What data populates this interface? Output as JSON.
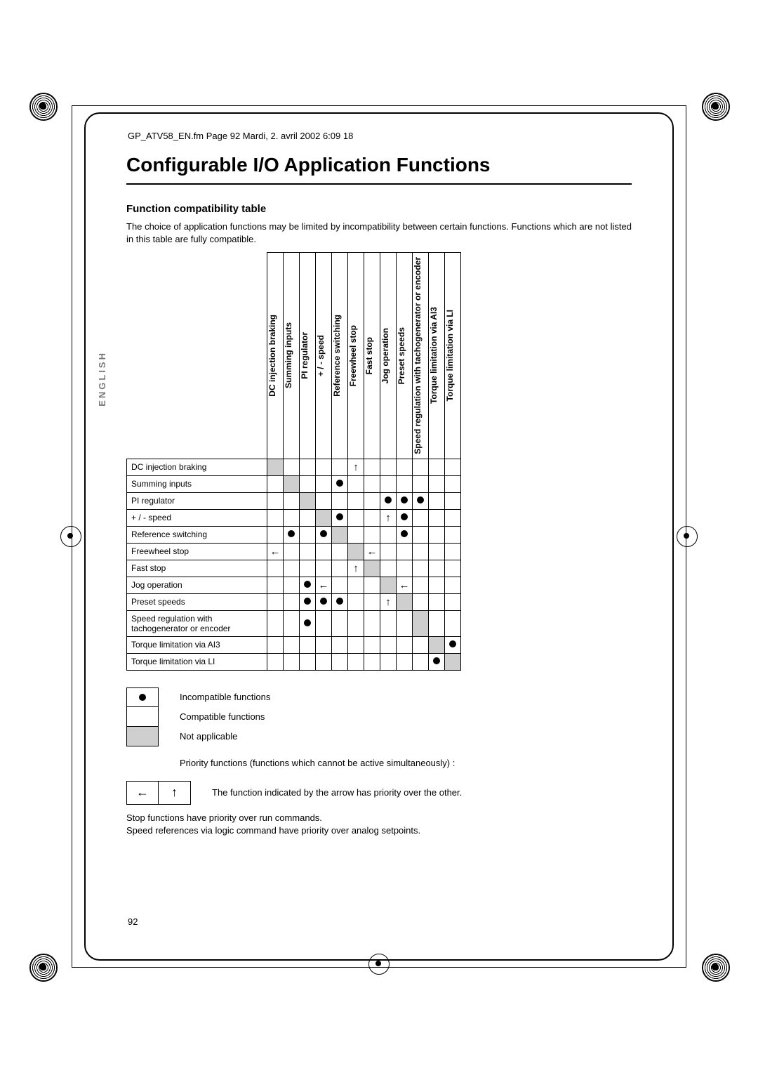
{
  "docinfo": "GP_ATV58_EN.fm  Page 92  Mardi, 2. avril 2002  6:09 18",
  "title": "Configurable I/O Application Functions",
  "subtitle": "Function compatibility table",
  "intro": "The choice of application functions may be limited by incompatibility between certain functions. Functions which are not listed in this table are fully compatible.",
  "language_tab": "ENGLISH",
  "page_number": "92",
  "columns": [
    "DC injection braking",
    "Summing inputs",
    "PI regulator",
    "+ / - speed",
    "Reference switching",
    "Freewheel stop",
    "Fast stop",
    "Jog operation",
    "Preset speeds",
    "Speed regulation with tachogenerator or encoder",
    "Torque limitation via AI3",
    "Torque limitation via LI"
  ],
  "rows": [
    {
      "label": "DC injection braking",
      "cells": [
        "na",
        "",
        "",
        "",
        "",
        "up",
        "",
        "",
        "",
        "",
        "",
        ""
      ]
    },
    {
      "label": "Summing inputs",
      "cells": [
        "",
        "na",
        "",
        "",
        "dot",
        "",
        "",
        "",
        "",
        "",
        "",
        ""
      ]
    },
    {
      "label": "PI regulator",
      "cells": [
        "",
        "",
        "na",
        "",
        "",
        "",
        "",
        "dot",
        "dot",
        "dot",
        "",
        ""
      ]
    },
    {
      "label": "+ / - speed",
      "cells": [
        "",
        "",
        "",
        "na",
        "dot",
        "",
        "",
        "up",
        "dot",
        "",
        "",
        ""
      ]
    },
    {
      "label": "Reference switching",
      "cells": [
        "",
        "dot",
        "",
        "dot",
        "na",
        "",
        "",
        "",
        "dot",
        "",
        "",
        ""
      ]
    },
    {
      "label": "Freewheel stop",
      "cells": [
        "left",
        "",
        "",
        "",
        "",
        "na",
        "left",
        "",
        "",
        "",
        "",
        ""
      ]
    },
    {
      "label": "Fast stop",
      "cells": [
        "",
        "",
        "",
        "",
        "",
        "up",
        "na",
        "",
        "",
        "",
        "",
        ""
      ]
    },
    {
      "label": "Jog operation",
      "cells": [
        "",
        "",
        "dot",
        "left",
        "",
        "",
        "",
        "na",
        "left",
        "",
        "",
        ""
      ]
    },
    {
      "label": "Preset speeds",
      "cells": [
        "",
        "",
        "dot",
        "dot",
        "dot",
        "",
        "",
        "up",
        "na",
        "",
        "",
        ""
      ]
    },
    {
      "label": "Speed regulation with tachogenerator or encoder",
      "cells": [
        "",
        "",
        "dot",
        "",
        "",
        "",
        "",
        "",
        "",
        "na",
        "",
        ""
      ]
    },
    {
      "label": "Torque limitation via AI3",
      "cells": [
        "",
        "",
        "",
        "",
        "",
        "",
        "",
        "",
        "",
        "",
        "na",
        "dot"
      ]
    },
    {
      "label": "Torque limitation via LI",
      "cells": [
        "",
        "",
        "",
        "",
        "",
        "",
        "",
        "",
        "",
        "",
        "dot",
        "na"
      ]
    }
  ],
  "legend": {
    "incompatible": "Incompatible functions",
    "compatible": "Compatible functions",
    "na": "Not applicable",
    "priority_intro": "Priority functions (functions which cannot be active simultaneously) :",
    "priority_note": "The function indicated by the arrow has priority over the other."
  },
  "notes": [
    "Stop functions have priority over run commands.",
    "Speed references via logic command have priority over analog setpoints."
  ],
  "glyphs": {
    "dot": "●",
    "up": "↑",
    "left": "←"
  }
}
